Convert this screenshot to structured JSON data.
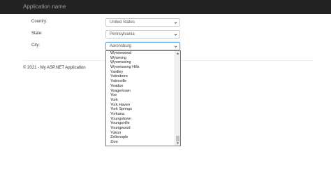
{
  "navbar": {
    "brand": "Application name"
  },
  "form": {
    "country": {
      "label": "Country:",
      "value": "United States"
    },
    "state": {
      "label": "State:",
      "value": "Pennsylvania"
    },
    "city": {
      "label": "City:",
      "value": "Aaronsburg",
      "visible_options": [
        "Wynnewood",
        "Wyoming",
        "Wyomissing",
        "Wyomissing Hills",
        "Yardley",
        "Yatesboro",
        "Yatesville",
        "Yeadon",
        "Yeagertown",
        "Yoe",
        "York",
        "York Haven",
        "York Springs",
        "Yorkana",
        "Youngstown",
        "Youngsville",
        "Youngwood",
        "Yukon",
        "Zelienople",
        "Zion"
      ]
    }
  },
  "footer": {
    "text": "© 2021 - My ASP.NET Application"
  },
  "icons": {
    "select_chevron": "chevron-down-icon",
    "scroll_up": "scroll-up-arrow-icon",
    "scroll_down": "scroll-down-arrow-icon"
  },
  "colors": {
    "navbar_bg": "#222222",
    "brand_text": "#9d9d9d",
    "focus_border": "#66afe9"
  }
}
